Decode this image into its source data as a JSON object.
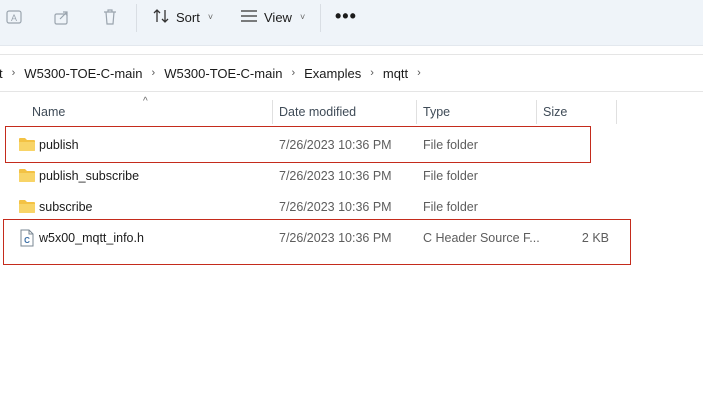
{
  "toolbar": {
    "sort_label": "Sort",
    "view_label": "View",
    "more_label": "•••",
    "chevron": "˅"
  },
  "breadcrumb": {
    "items": [
      "t",
      "W5300-TOE-C-main",
      "W5300-TOE-C-main",
      "Examples",
      "mqtt"
    ],
    "separator": "›"
  },
  "columns": {
    "name": "Name",
    "date": "Date modified",
    "type": "Type",
    "size": "Size",
    "sort_indicator": "^"
  },
  "files": [
    {
      "name": "publish",
      "date": "7/26/2023 10:36 PM",
      "type": "File folder",
      "size": "",
      "icon": "folder-icon"
    },
    {
      "name": "publish_subscribe",
      "date": "7/26/2023 10:36 PM",
      "type": "File folder",
      "size": "",
      "icon": "folder-icon"
    },
    {
      "name": "subscribe",
      "date": "7/26/2023 10:36 PM",
      "type": "File folder",
      "size": "",
      "icon": "folder-icon"
    },
    {
      "name": "w5x00_mqtt_info.h",
      "date": "7/26/2023 10:36 PM",
      "type": "C Header Source F...",
      "size": "2 KB",
      "icon": "c-header-file-icon"
    }
  ],
  "colors": {
    "toolbar_bg": "#eff4f9",
    "folder": "#f3c244",
    "highlight": "#c42b1c"
  }
}
